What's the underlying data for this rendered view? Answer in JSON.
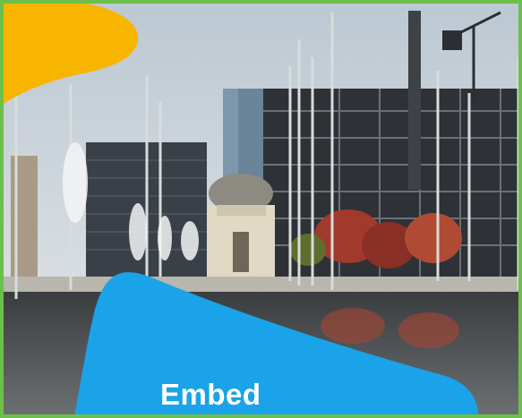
{
  "banner": {
    "embed_label": "Embed"
  },
  "colors": {
    "frame_border": "#6cc04a",
    "accent_yellow": "#f7b500",
    "accent_blue": "#1aa3e8",
    "label_text": "#ffffff"
  },
  "image": {
    "icon": "city-square-photo"
  }
}
